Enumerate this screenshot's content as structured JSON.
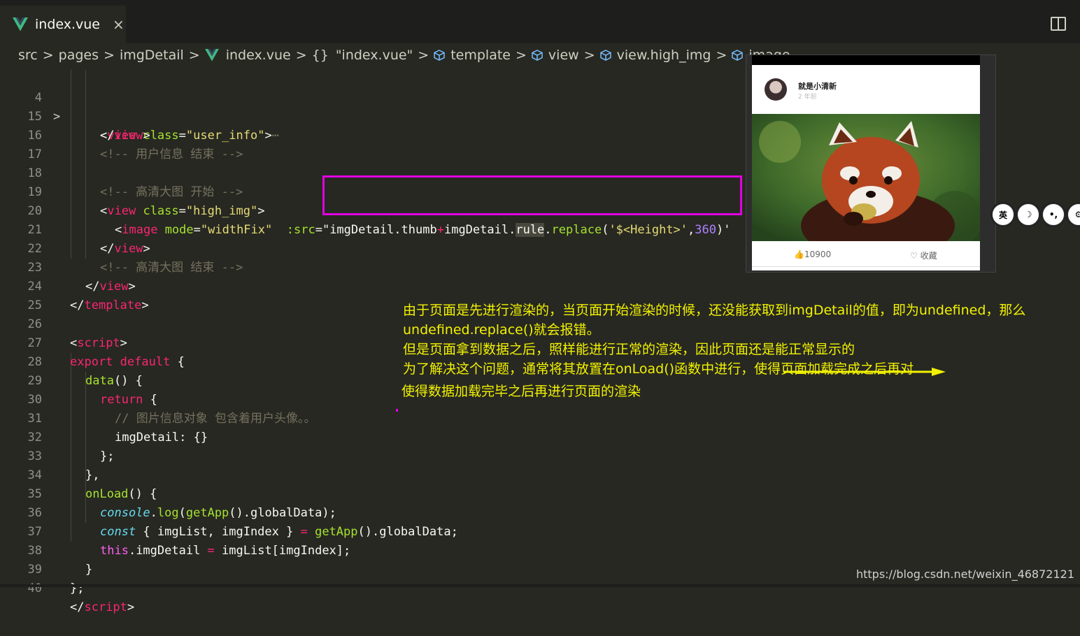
{
  "tab": {
    "title": "index.vue",
    "close": "×"
  },
  "breadcrumb": {
    "src": "src",
    "pages": "pages",
    "imgDetail": "imgDetail",
    "file": "index.vue",
    "braces": "{}",
    "script": "\"index.vue\"",
    "template": "template",
    "view": "view",
    "view_high": "view.high_img",
    "image": "image",
    "sep": ">"
  },
  "line_numbers": [
    "4",
    "15",
    "16",
    "17",
    "18",
    "19",
    "20",
    "21",
    "22",
    "23",
    "24",
    "25",
    "26",
    "27",
    "28",
    "29",
    "30",
    "31",
    "32",
    "33",
    "34",
    "35",
    "36",
    "37",
    "38",
    "39",
    "40"
  ],
  "code_text": {
    "l4_tag": "view",
    "l4_attr": "class",
    "l4_val": "\"user_info\"",
    "l4_fold": "⋯",
    "l15_tag": "view",
    "l16_comment": "<!-- 用户信息 结束 -->",
    "l18_comment": "<!-- 高清大图 开始 -->",
    "l19_tag": "view",
    "l19_attr": "class",
    "l19_val": "\"high_img\"",
    "l20_tag": "image",
    "l20_attr1": "mode",
    "l20_val1": "\"widthFix\"",
    "l20_attr2": ":src",
    "l20_q": "\"",
    "l20_expr1": "imgDetail.thumb",
    "l20_plus": "+",
    "l20_expr2": "imgDetail.",
    "l20_rule": "rule",
    "l20_dot": ".",
    "l20_replace": "replace",
    "l20_paren": "(",
    "l20_str": "'$<Height>'",
    "l20_comma": ",",
    "l20_num": "360",
    "l20_close": ")'",
    "l21_tag": "view",
    "l22_comment": "<!-- 高清大图 结束 -->",
    "l23_tag": "view",
    "l24_tag": "template",
    "l26_tag": "script",
    "l27_export": "export",
    "l27_default": "default",
    "l27_rest": " {",
    "l28_fn": "data",
    "l28_rest": "() {",
    "l29_return": "return",
    "l29_rest": " {",
    "l30_comment": "// 图片信息对象 包含着用户头像。。",
    "l31_text": "imgDetail: {}",
    "l32_text": "};",
    "l33_text": "},",
    "l34_fn": "onLoad",
    "l34_rest": "() {",
    "l35_console": "console",
    "l35_dot": ".",
    "l35_log": "log",
    "l35_p1": "(",
    "l35_getapp": "getApp",
    "l35_rest": "().globalData);",
    "l36_const": "const",
    "l36_mid": " { imgList, imgIndex } ",
    "l36_eq": "=",
    "l36_sp": " ",
    "l36_getapp": "getApp",
    "l36_rest": "().globalData;",
    "l37_this": "this",
    "l37_mid": ".imgDetail ",
    "l37_eq": "=",
    "l37_rest": " imgList[imgIndex];",
    "l38_text": "}",
    "l39_text": "};",
    "l40_tag": "script"
  },
  "preview": {
    "username": "就是小清新",
    "time": "2 年前",
    "likes": "10900",
    "favorite": "收藏"
  },
  "side_buttons": [
    "英",
    "☽",
    "•,",
    "⚙"
  ],
  "notes": [
    "由于页面是先进行渲染的，当页面开始渲染的时候，还没能获取到imgDetail的值，即为undefined，那么",
    "undefined.replace()就会报错。",
    "但是页面拿到数据之后，照样能进行正常的渲染，因此页面还是能正常显示的",
    "为了解决这个问题，通常将其放置在onLoad()函数中进行，使得页面加载完成之后再对",
    "使得数据加载完毕之后再进行页面的渲染"
  ],
  "watermark": "https://blog.csdn.net/weixin_46872121",
  "colors": {
    "highlight_box": "#e100e1",
    "note_text": "#f2f200",
    "editor_bg": "#272822"
  }
}
